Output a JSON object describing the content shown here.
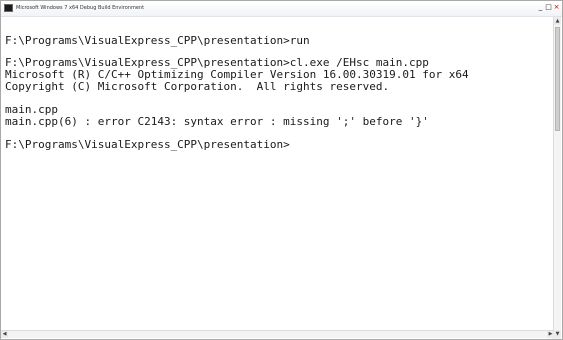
{
  "window": {
    "title": "Microsoft Windows 7 x64 Debug Build Environment",
    "controls": {
      "minimize": "_",
      "maximize": "□",
      "close": "×"
    },
    "icon": "console-icon"
  },
  "console": {
    "lines": [
      "F:\\Programs\\VisualExpress_CPP\\presentation>run",
      "F:\\Programs\\VisualExpress_CPP\\presentation>cl.exe /EHsc main.cpp",
      "Microsoft (R) C/C++ Optimizing Compiler Version 16.00.30319.01 for x64",
      "Copyright (C) Microsoft Corporation.  All rights reserved.",
      "main.cpp",
      "main.cpp(6) : error C2143: syntax error : missing ';' before '}'",
      "F:\\Programs\\VisualExpress_CPP\\presentation>"
    ]
  },
  "scrollbars": {
    "up_arrow": "▲",
    "down_arrow": "▼",
    "left_arrow": "◀",
    "right_arrow": "▶"
  }
}
